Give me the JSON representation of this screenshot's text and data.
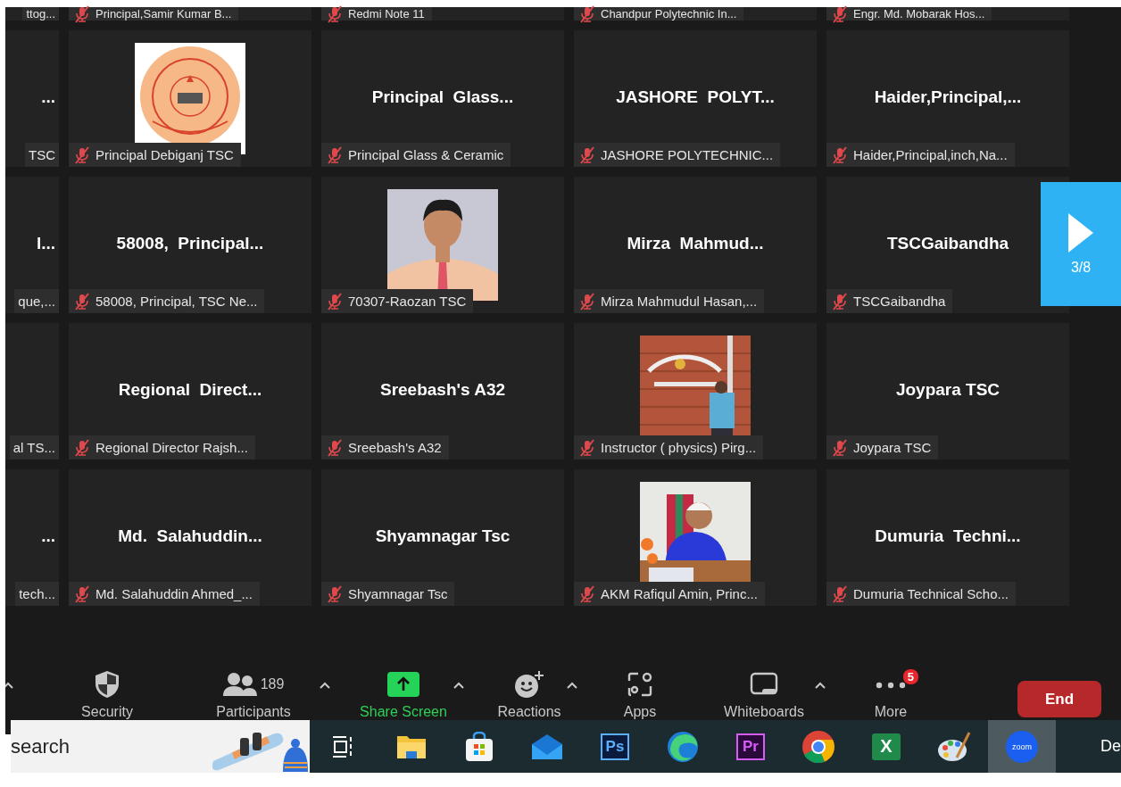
{
  "grid": {
    "rows": [
      {
        "kind": "strip",
        "tiles": [
          {
            "kind": "edge",
            "label": "ttog..."
          },
          {
            "kind": "name",
            "label": "Principal,Samir Kumar B...",
            "muted": true
          },
          {
            "kind": "name",
            "label": "Redmi Note 11",
            "muted": true
          },
          {
            "kind": "name",
            "label": "Chandpur Polytechnic In...",
            "muted": true
          },
          {
            "kind": "name",
            "label": "Engr. Md. Mobarak Hos...",
            "muted": true
          }
        ]
      },
      {
        "kind": "full",
        "tiles": [
          {
            "kind": "edge",
            "title": "...",
            "label": "TSC"
          },
          {
            "kind": "picture",
            "label": "Principal Debiganj TSC",
            "muted": true
          },
          {
            "kind": "name",
            "title": "Principal  Glass...",
            "label": "Principal Glass & Ceramic",
            "muted": true
          },
          {
            "kind": "name",
            "title": "JASHORE  POLYT...",
            "label": "JASHORE POLYTECHNIC...",
            "muted": true
          },
          {
            "kind": "name",
            "title": "Haider,Principal,...",
            "label": "Haider,Principal,inch,Na...",
            "muted": true
          }
        ]
      },
      {
        "kind": "full",
        "tiles": [
          {
            "kind": "edge",
            "title": "l...",
            "label": "que,..."
          },
          {
            "kind": "name",
            "title": "58008,  Principal...",
            "label": "58008, Principal, TSC Ne...",
            "muted": true
          },
          {
            "kind": "picture",
            "label": "70307-Raozan TSC",
            "muted": true
          },
          {
            "kind": "name",
            "title": "Mirza  Mahmud...",
            "label": "Mirza Mahmudul Hasan,...",
            "muted": true
          },
          {
            "kind": "name",
            "title": "TSCGaibandha",
            "label": "TSCGaibandha",
            "muted": true
          }
        ]
      },
      {
        "kind": "full",
        "tiles": [
          {
            "kind": "edge",
            "label": "al TS..."
          },
          {
            "kind": "name",
            "title": "Regional  Direct...",
            "label": "Regional Director Rajsh...",
            "muted": true
          },
          {
            "kind": "name",
            "title": "Sreebash's A32",
            "label": "Sreebash's A32",
            "muted": true
          },
          {
            "kind": "picture",
            "label": "Instructor ( physics) Pirg...",
            "muted": true
          },
          {
            "kind": "name",
            "title": "Joypara TSC",
            "label": "Joypara TSC",
            "muted": true
          }
        ]
      },
      {
        "kind": "full",
        "tiles": [
          {
            "kind": "edge",
            "title": "...",
            "label": "tech..."
          },
          {
            "kind": "name",
            "title": "Md.  Salahuddin...",
            "label": "Md. Salahuddin Ahmed_...",
            "muted": true
          },
          {
            "kind": "name",
            "title": "Shyamnagar Tsc",
            "label": "Shyamnagar Tsc",
            "muted": true
          },
          {
            "kind": "picture",
            "label": "AKM Rafiqul Amin, Princ...",
            "muted": true
          },
          {
            "kind": "name",
            "title": "Dumuria  Techni...",
            "label": "Dumuria Technical Scho...",
            "muted": true
          }
        ]
      }
    ]
  },
  "next_page": {
    "label": "3/8"
  },
  "toolbar": {
    "items": [
      {
        "kind": "security",
        "label": "Security",
        "caret": false
      },
      {
        "kind": "participants",
        "label": "Participants",
        "count": "189",
        "caret": true
      },
      {
        "kind": "share",
        "label": "Share Screen",
        "caret": true
      },
      {
        "kind": "reactions",
        "label": "Reactions",
        "caret": true
      },
      {
        "kind": "apps",
        "label": "Apps",
        "caret": false
      },
      {
        "kind": "whiteboards",
        "label": "Whiteboards",
        "caret": true
      },
      {
        "kind": "more",
        "label": "More",
        "badge": "5",
        "caret": false
      }
    ],
    "end_button": "End"
  },
  "taskbar": {
    "search": {
      "placeholder": "search"
    },
    "apps": [
      {
        "kind": "taskview",
        "selected": false
      },
      {
        "kind": "folder",
        "selected": false
      },
      {
        "kind": "store",
        "selected": false
      },
      {
        "kind": "mail",
        "selected": false
      },
      {
        "kind": "ps",
        "text": "Ps",
        "selected": false
      },
      {
        "kind": "edge",
        "selected": false
      },
      {
        "kind": "pr",
        "text": "Pr",
        "selected": false
      },
      {
        "kind": "chrome",
        "selected": false
      },
      {
        "kind": "excel",
        "text": "X",
        "selected": false
      },
      {
        "kind": "paint",
        "selected": false
      },
      {
        "kind": "zoom",
        "text": "zoom",
        "selected": true
      }
    ],
    "clock": "De"
  }
}
